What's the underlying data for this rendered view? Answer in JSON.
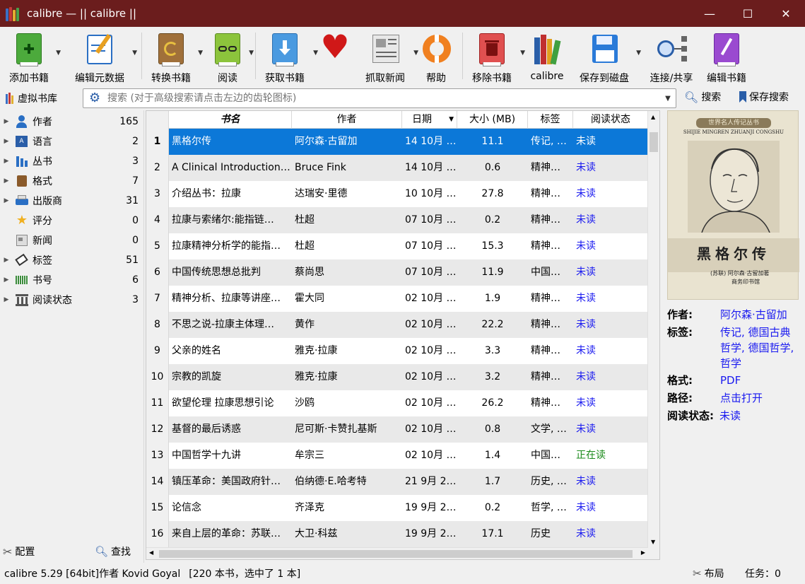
{
  "window": {
    "title": "calibre — || calibre ||",
    "minimize": "—",
    "maximize": "☐",
    "close": "✕"
  },
  "toolbar": {
    "add_books": "添加书籍",
    "edit_metadata": "编辑元数据",
    "convert_books": "转换书籍",
    "view": "阅读",
    "get_books": "获取书籍",
    "fetch_news": "抓取新闻",
    "help": "帮助",
    "remove_books": "移除书籍",
    "calibre": "calibre",
    "save_to_disk": "保存到磁盘",
    "connect_share": "连接/共享",
    "edit_book": "编辑书籍"
  },
  "search": {
    "virtual_library": "虚拟书库",
    "placeholder": "搜索 (对于高级搜索请点击左边的齿轮图标)",
    "search_label": "搜索",
    "saved_search_label": "保存搜索"
  },
  "tag_browser": {
    "items": [
      {
        "name": "作者",
        "count": "165"
      },
      {
        "name": "语言",
        "count": "2"
      },
      {
        "name": "丛书",
        "count": "3"
      },
      {
        "name": "格式",
        "count": "7"
      },
      {
        "name": "出版商",
        "count": "31"
      },
      {
        "name": "评分",
        "count": "0"
      },
      {
        "name": "新闻",
        "count": "0"
      },
      {
        "name": "标签",
        "count": "51"
      },
      {
        "name": "书号",
        "count": "6"
      },
      {
        "name": "阅读状态",
        "count": "3"
      }
    ],
    "configure": "配置",
    "find": "查找"
  },
  "book_list": {
    "columns": [
      "书名",
      "作者",
      "日期",
      "大小 (MB)",
      "标签",
      "阅读状态"
    ],
    "rows": [
      {
        "n": "1",
        "title": "黑格尔传",
        "author": "阿尔森·古留加",
        "date": "14 10月 …",
        "size": "11.1",
        "tags": "传记, …",
        "status": "未读"
      },
      {
        "n": "2",
        "title": "A Clinical Introduction…",
        "author": "Bruce Fink",
        "date": "14 10月 …",
        "size": "0.6",
        "tags": "精神…",
        "status": "未读"
      },
      {
        "n": "3",
        "title": "介绍丛书：拉康",
        "author": "达瑞安·里德",
        "date": "10 10月 …",
        "size": "27.8",
        "tags": "精神…",
        "status": "未读"
      },
      {
        "n": "4",
        "title": "拉康与索绪尔:能指链…",
        "author": "杜超",
        "date": "07 10月 …",
        "size": "0.2",
        "tags": "精神…",
        "status": "未读"
      },
      {
        "n": "5",
        "title": "拉康精神分析学的能指…",
        "author": "杜超",
        "date": "07 10月 …",
        "size": "15.3",
        "tags": "精神…",
        "status": "未读"
      },
      {
        "n": "6",
        "title": "中国传统思想总批判",
        "author": "蔡尚思",
        "date": "07 10月 …",
        "size": "11.9",
        "tags": "中国…",
        "status": "未读"
      },
      {
        "n": "7",
        "title": "精神分析、拉康等讲座…",
        "author": "霍大同",
        "date": "02 10月 …",
        "size": "1.9",
        "tags": "精神…",
        "status": "未读"
      },
      {
        "n": "8",
        "title": "不思之说-拉康主体理…",
        "author": "黄作",
        "date": "02 10月 …",
        "size": "22.2",
        "tags": "精神…",
        "status": "未读"
      },
      {
        "n": "9",
        "title": "父亲的姓名",
        "author": "雅克·拉康",
        "date": "02 10月 …",
        "size": "3.3",
        "tags": "精神…",
        "status": "未读"
      },
      {
        "n": "10",
        "title": "宗教的凯旋",
        "author": "雅克·拉康",
        "date": "02 10月 …",
        "size": "3.2",
        "tags": "精神…",
        "status": "未读"
      },
      {
        "n": "11",
        "title": "欲望伦理 拉康思想引论",
        "author": "沙鸥",
        "date": "02 10月 …",
        "size": "26.2",
        "tags": "精神…",
        "status": "未读"
      },
      {
        "n": "12",
        "title": "基督的最后诱惑",
        "author": "尼可斯·卡赞扎基斯",
        "date": "02 10月 …",
        "size": "0.8",
        "tags": "文学, …",
        "status": "未读"
      },
      {
        "n": "13",
        "title": "中国哲学十九讲",
        "author": "牟宗三",
        "date": "02 10月 …",
        "size": "1.4",
        "tags": "中国…",
        "status": "正在读"
      },
      {
        "n": "14",
        "title": "镇压革命：美国政府针…",
        "author": "伯纳德·E.哈考特",
        "date": "21 9月 2…",
        "size": "1.7",
        "tags": "历史, …",
        "status": "未读"
      },
      {
        "n": "15",
        "title": "论信念",
        "author": "齐泽克",
        "date": "19 9月 2…",
        "size": "0.2",
        "tags": "哲学, …",
        "status": "未读"
      },
      {
        "n": "16",
        "title": "来自上层的革命：苏联…",
        "author": "大卫·科兹",
        "date": "19 9月 2…",
        "size": "17.1",
        "tags": "历史",
        "status": "未读"
      }
    ]
  },
  "cover": {
    "series_text": "世界名人传记丛书",
    "pinyin": "SHIJIE MINGREN ZHUANJI CONGSHU",
    "title": "黑格尔传",
    "author_line": "(苏联) 阿尔森·古留加著",
    "publisher": "商务印书馆"
  },
  "details": {
    "author_label": "作者:",
    "author": "阿尔森·古留加",
    "tags_label": "标签:",
    "tags_line1": "传记, 德国古典",
    "tags_line2": "哲学, 德国哲学,",
    "tags_line3": "哲学",
    "formats_label": "格式:",
    "formats": "PDF",
    "path_label": "路径:",
    "path": "点击打开",
    "status_label": "阅读状态:",
    "status": "未读"
  },
  "statusbar": {
    "version": "calibre 5.29 [64bit]作者 Kovid Goyal",
    "count": "[220 本书，选中了 1 本]",
    "layout": "布局",
    "jobs": "任务：0"
  }
}
